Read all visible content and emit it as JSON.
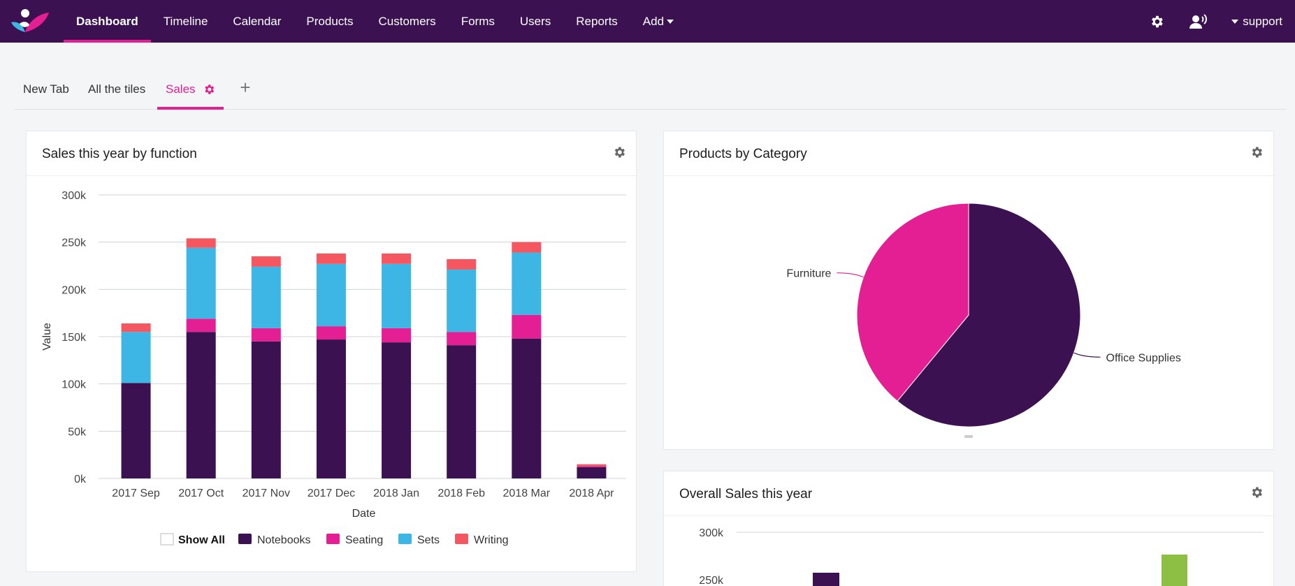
{
  "nav": {
    "items": [
      {
        "label": "Dashboard",
        "active": true
      },
      {
        "label": "Timeline"
      },
      {
        "label": "Calendar"
      },
      {
        "label": "Products"
      },
      {
        "label": "Customers"
      },
      {
        "label": "Forms"
      },
      {
        "label": "Users"
      },
      {
        "label": "Reports"
      },
      {
        "label": "Add"
      }
    ],
    "user": "support",
    "icons": [
      "gear-icon",
      "user-voice-icon"
    ]
  },
  "tabs": [
    {
      "label": "New Tab"
    },
    {
      "label": "All the tiles"
    },
    {
      "label": "Sales",
      "active": true
    }
  ],
  "colors": {
    "brand": "#3b1152",
    "accent": "#e31f93",
    "sets": "#3eb6e5",
    "writing": "#f4575f",
    "green": "#8cbf43"
  },
  "cards": {
    "sales_by_function": {
      "title": "Sales this year by function"
    },
    "products_by_category": {
      "title": "Products by Category"
    },
    "overall_sales": {
      "title": "Overall Sales this year"
    }
  },
  "chart_data": [
    {
      "type": "bar",
      "stacked": true,
      "title": "Sales this year by function",
      "xlabel": "Date",
      "ylabel": "Value",
      "ylim": [
        0,
        300000
      ],
      "yticks": [
        "0k",
        "50k",
        "100k",
        "150k",
        "200k",
        "250k",
        "300k"
      ],
      "categories": [
        "2017 Sep",
        "2017 Oct",
        "2017 Nov",
        "2017 Dec",
        "2018 Jan",
        "2018 Feb",
        "2018 Mar",
        "2018 Apr"
      ],
      "series": [
        {
          "name": "Notebooks",
          "color": "#3b1152",
          "values": [
            101000,
            155000,
            145000,
            147000,
            144000,
            141000,
            148000,
            12000
          ]
        },
        {
          "name": "Seating",
          "color": "#e31f93",
          "values": [
            0,
            14000,
            14000,
            14000,
            15000,
            14000,
            25000,
            1000
          ]
        },
        {
          "name": "Sets",
          "color": "#3eb6e5",
          "values": [
            54000,
            75000,
            65000,
            66000,
            68000,
            66000,
            66000,
            0
          ]
        },
        {
          "name": "Writing",
          "color": "#f4575f",
          "values": [
            9000,
            10000,
            11000,
            11000,
            11000,
            11000,
            11000,
            2000
          ]
        }
      ],
      "legend": {
        "show_all": "Show All",
        "placement": "bottom"
      },
      "grid": true
    },
    {
      "type": "pie",
      "title": "Products by Category",
      "slices": [
        {
          "label": "Office Supplies",
          "value": 61,
          "color": "#3b1152"
        },
        {
          "label": "Furniture",
          "value": 39,
          "color": "#e31f93"
        }
      ]
    },
    {
      "type": "bar",
      "title": "Overall Sales this year",
      "yticks": [
        "300k",
        "250k"
      ],
      "ylim": [
        250000,
        300000
      ],
      "series_colors": [
        "#3b1152",
        "#8cbf43"
      ]
    }
  ]
}
